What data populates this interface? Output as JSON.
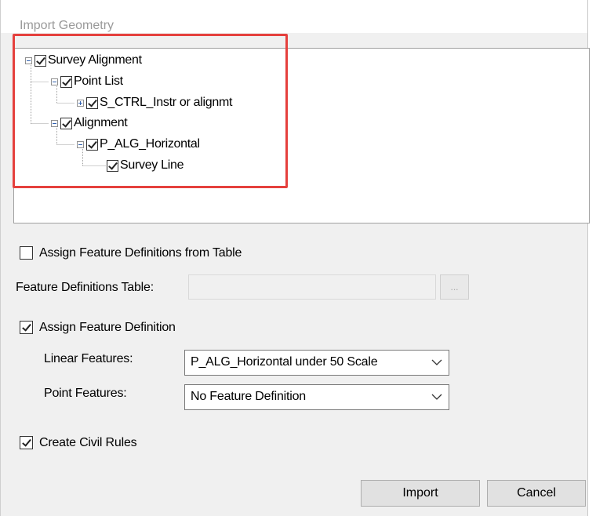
{
  "dialog": {
    "title": "Import Geometry"
  },
  "tree": [
    {
      "label": "Survey Alignment",
      "checked": true,
      "expander": "minus"
    },
    {
      "label": "Point List",
      "checked": true,
      "expander": "minus"
    },
    {
      "label": "S_CTRL_Instr or alignmt",
      "checked": true,
      "expander": "plus"
    },
    {
      "label": "Alignment",
      "checked": true,
      "expander": "minus"
    },
    {
      "label": "P_ALG_Horizontal",
      "checked": true,
      "expander": "minus"
    },
    {
      "label": "Survey Line",
      "checked": true,
      "expander": "none"
    }
  ],
  "options": {
    "assign_from_table": {
      "label": "Assign Feature Definitions from Table",
      "checked": false
    },
    "feature_table_label": "Feature Definitions Table:",
    "feature_table_value": "",
    "browse_label": "...",
    "assign_feature_definition": {
      "label": "Assign Feature Definition",
      "checked": true
    },
    "linear_features_label": "Linear Features:",
    "linear_features_value": "P_ALG_Horizontal under 50 Scale",
    "point_features_label": "Point Features:",
    "point_features_value": "No Feature Definition",
    "create_civil_rules": {
      "label": "Create Civil Rules",
      "checked": true
    }
  },
  "buttons": {
    "import": "Import",
    "cancel": "Cancel"
  },
  "colors": {
    "highlight": "#e5403d",
    "tree_line": "#a0a0a0",
    "expander_sign": "#3060b0"
  }
}
